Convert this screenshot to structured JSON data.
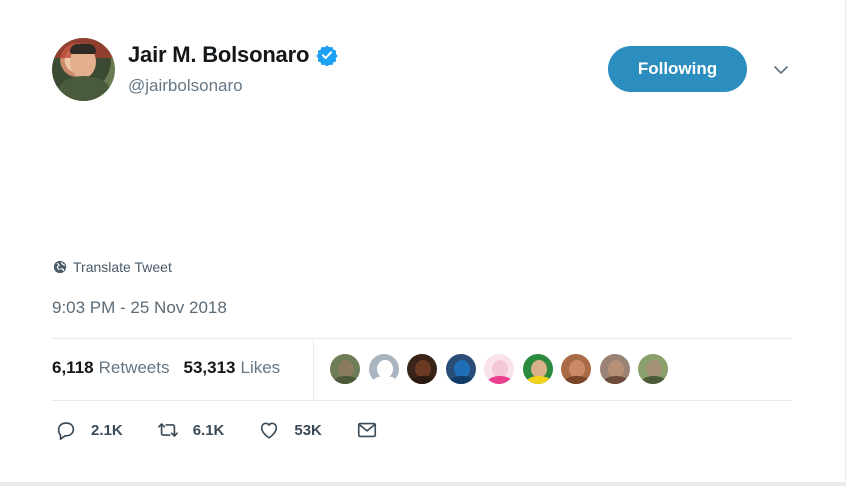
{
  "author": {
    "display_name": "Jair M. Bolsonaro",
    "handle": "@jairbolsonaro",
    "verified": true
  },
  "follow_button": {
    "label": "Following",
    "color": "#2b8ebf"
  },
  "translate": {
    "label": "Translate Tweet"
  },
  "timestamp": "9:03 PM - 25 Nov 2018",
  "stats": {
    "retweets_count": "6,118",
    "retweets_label": "Retweets",
    "likes_count": "53,313",
    "likes_label": "Likes"
  },
  "likers": [
    {
      "face": "#8a7a60",
      "body": "#4d5a3a",
      "bg": "#6d7d58"
    },
    {
      "face": "#ffffff",
      "body": "#ffffff",
      "bg": "#a9b6c1"
    },
    {
      "face": "#6a3a22",
      "body": "#2a1a12",
      "bg": "#3a2418"
    },
    {
      "face": "#1f6fb8",
      "body": "#123c66",
      "bg": "#2a4d78"
    },
    {
      "face": "#f4c6d8",
      "body": "#e83f8e",
      "bg": "#f9e2ec"
    },
    {
      "face": "#d9b08a",
      "body": "#f2d21a",
      "bg": "#2b8a3e"
    },
    {
      "face": "#c98866",
      "body": "#7a4428",
      "bg": "#a96a48"
    },
    {
      "face": "#b89078",
      "body": "#6e4a3a",
      "bg": "#9a8374"
    },
    {
      "face": "#a39276",
      "body": "#4c5b38",
      "bg": "#8aa06a"
    }
  ],
  "actions": {
    "reply_count": "2.1K",
    "retweet_count": "6.1K",
    "like_count": "53K"
  }
}
